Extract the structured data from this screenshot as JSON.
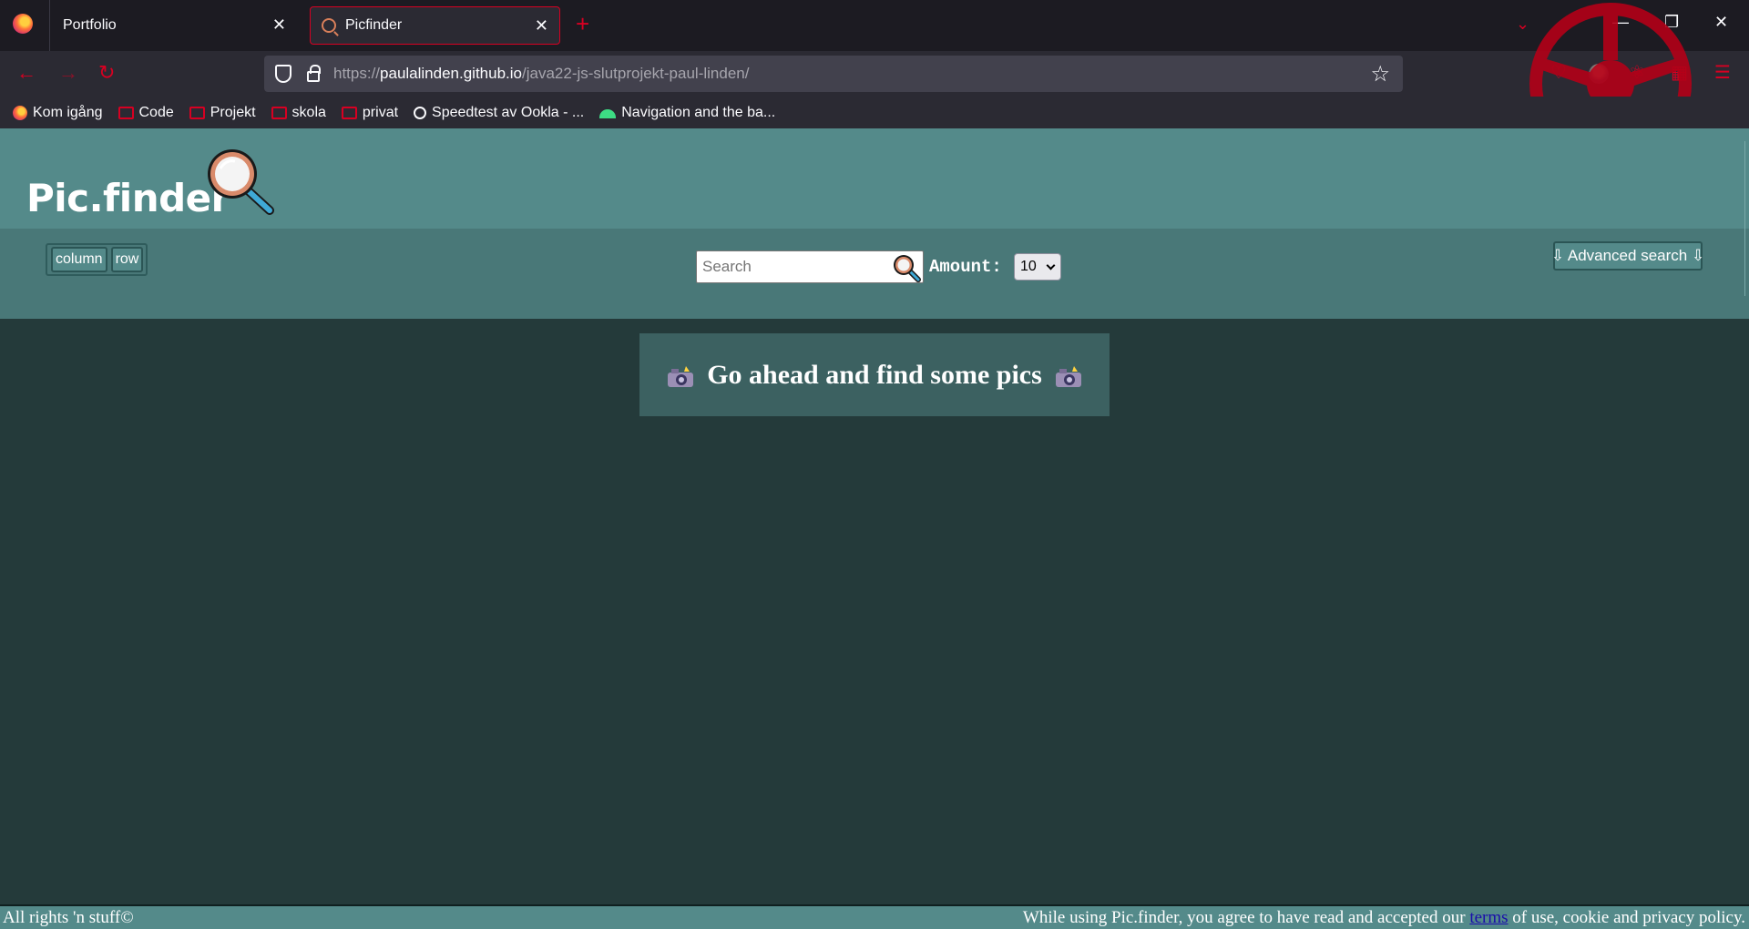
{
  "browser": {
    "tabs": [
      {
        "title": "Portfolio",
        "close": "✕"
      },
      {
        "title": "Picfinder",
        "close": "✕"
      }
    ],
    "new_tab": "+",
    "url": {
      "scheme": "https://",
      "host": "paulalinden.github.io",
      "path": "/java22-js-slutprojekt-paul-linden/"
    },
    "bookmarks": [
      {
        "label": "Kom igång",
        "icon": "firefox"
      },
      {
        "label": "Code",
        "icon": "folder"
      },
      {
        "label": "Projekt",
        "icon": "folder"
      },
      {
        "label": "skola",
        "icon": "folder"
      },
      {
        "label": "privat",
        "icon": "folder"
      },
      {
        "label": "Speedtest av Ookla - ...",
        "icon": "gauge"
      },
      {
        "label": "Navigation and the ba...",
        "icon": "android"
      }
    ],
    "accent_color": "#d70022"
  },
  "site": {
    "logo": "Pic.finder",
    "layout_buttons": {
      "column": "column",
      "row": "row"
    },
    "search": {
      "placeholder": "Search"
    },
    "amount": {
      "label": "Amount:",
      "value": "10"
    },
    "advanced": "⇩ Advanced search ⇩",
    "message": "Go ahead and find some pics",
    "footer": {
      "left": "All rights 'n stuff©",
      "right_before": "While using Pic.finder, you agree to have read and accepted our",
      "link": "terms",
      "right_after": "of use, cookie and privacy policy."
    },
    "colors": {
      "header": "#548a8a",
      "toolbar": "#497878",
      "background": "#243a3a",
      "message_box": "#3c6161"
    }
  }
}
